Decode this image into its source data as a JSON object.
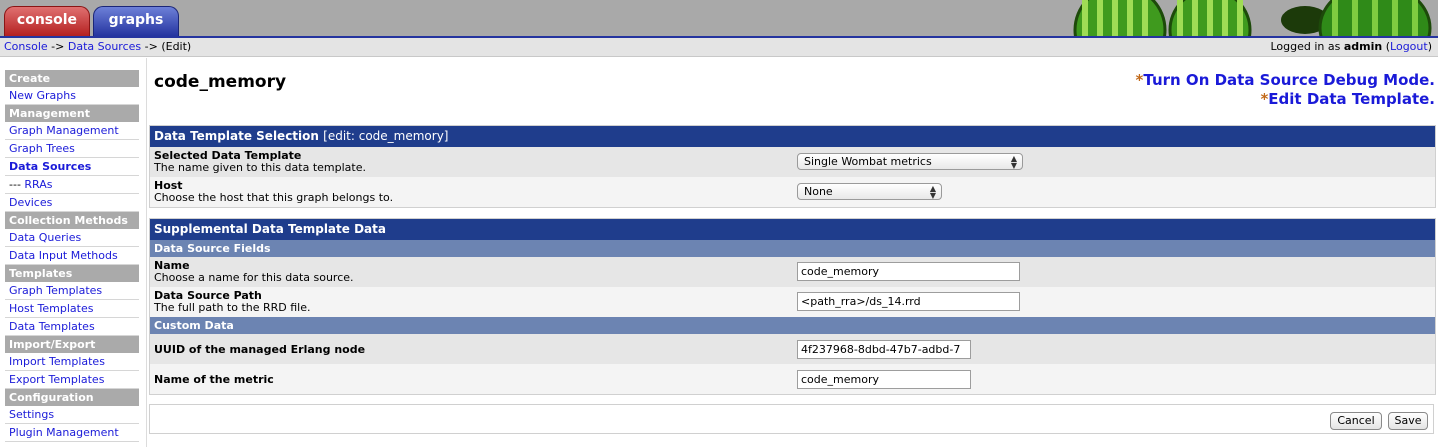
{
  "tabs": {
    "console": "console",
    "graphs": "graphs"
  },
  "breadcrumb": {
    "console": "Console",
    "sep1": " -> ",
    "data_sources": "Data Sources",
    "sep2": " -> ",
    "current": "(Edit)"
  },
  "login": {
    "prefix": "Logged in as ",
    "user": "admin",
    "open": " (",
    "logout": "Logout",
    "close": ")"
  },
  "sidebar": {
    "sections": [
      {
        "title": "Create",
        "items": [
          {
            "label": "New Graphs"
          }
        ]
      },
      {
        "title": "Management",
        "items": [
          {
            "label": "Graph Management"
          },
          {
            "label": "Graph Trees"
          },
          {
            "label": "Data Sources",
            "active": true
          },
          {
            "prefix": "--- ",
            "label": "RRAs"
          },
          {
            "label": "Devices"
          }
        ]
      },
      {
        "title": "Collection Methods",
        "items": [
          {
            "label": "Data Queries"
          },
          {
            "label": "Data Input Methods"
          }
        ]
      },
      {
        "title": "Templates",
        "items": [
          {
            "label": "Graph Templates"
          },
          {
            "label": "Host Templates"
          },
          {
            "label": "Data Templates"
          }
        ]
      },
      {
        "title": "Import/Export",
        "items": [
          {
            "label": "Import Templates"
          },
          {
            "label": "Export Templates"
          }
        ]
      },
      {
        "title": "Configuration",
        "items": [
          {
            "label": "Settings"
          },
          {
            "label": "Plugin Management"
          }
        ]
      }
    ]
  },
  "page": {
    "title": "code_memory",
    "actions": [
      {
        "star": "*",
        "label": "Turn On Data Source Debug Mode."
      },
      {
        "star": "*",
        "label": "Edit Data Template."
      }
    ]
  },
  "template_selection": {
    "header": "Data Template Selection",
    "header_edit": "[edit: code_memory]",
    "selected_template": {
      "label": "Selected Data Template",
      "desc": "The name given to this data template.",
      "value": "Single Wombat metrics"
    },
    "host": {
      "label": "Host",
      "desc": "Choose the host that this graph belongs to.",
      "value": "None"
    }
  },
  "supplemental": {
    "header": "Supplemental Data Template Data",
    "fields_header": "Data Source Fields",
    "name": {
      "label": "Name",
      "desc": "Choose a name for this data source.",
      "value": "code_memory"
    },
    "path": {
      "label": "Data Source Path",
      "desc": "The full path to the RRD file.",
      "value": "<path_rra>/ds_14.rrd"
    },
    "custom_header": "Custom Data",
    "uuid": {
      "label": "UUID of the managed Erlang node",
      "value": "4f237968-8dbd-47b7-adbd-7"
    },
    "metric": {
      "label": "Name of the metric",
      "value": "code_memory"
    }
  },
  "buttons": {
    "cancel": "Cancel",
    "save": "Save"
  },
  "colors": {
    "header_blue": "#1f3d8c",
    "subheader_blue": "#6c84b2",
    "link": "#1a1ad8",
    "console_tab": "#b42020",
    "graphs_tab": "#25349f"
  }
}
